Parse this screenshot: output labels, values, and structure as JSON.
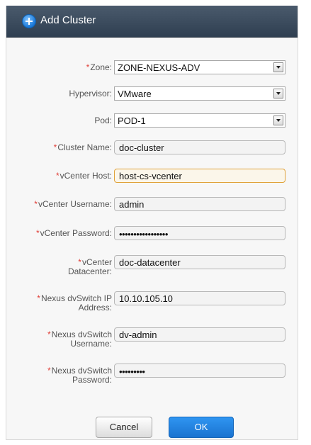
{
  "dialog": {
    "title": "Add Cluster",
    "title_icon": "plus-circle-icon",
    "accent": "#1a73d0",
    "required_marker": "*",
    "required_color": "#e0413a"
  },
  "fields": {
    "zone": {
      "label": "Zone:",
      "value": "ZONE-NEXUS-ADV"
    },
    "hypervisor": {
      "label": "Hypervisor:",
      "value": "VMware"
    },
    "pod": {
      "label": "Pod:",
      "value": "POD-1"
    },
    "cluster_name": {
      "label": "Cluster Name:",
      "value": "doc-cluster"
    },
    "vcenter_host": {
      "label": "vCenter Host:",
      "value": "host-cs-vcenter"
    },
    "vcenter_username": {
      "label": "vCenter Username:",
      "value": "admin"
    },
    "vcenter_password": {
      "label": "vCenter Password:",
      "value": "•••••••••••••••••"
    },
    "vcenter_datacenter": {
      "label_line1": "vCenter",
      "label_line2": "Datacenter:",
      "value": "doc-datacenter"
    },
    "nexus_ip": {
      "label_line1": "Nexus dvSwitch IP",
      "label_line2": "Address:",
      "value": "10.10.105.10"
    },
    "nexus_username": {
      "label_line1": "Nexus dvSwitch",
      "label_line2": "Username:",
      "value": "dv-admin"
    },
    "nexus_password": {
      "label_line1": "Nexus dvSwitch",
      "label_line2": "Password:",
      "value": "•••••••••"
    }
  },
  "buttons": {
    "cancel": "Cancel",
    "ok": "OK"
  }
}
